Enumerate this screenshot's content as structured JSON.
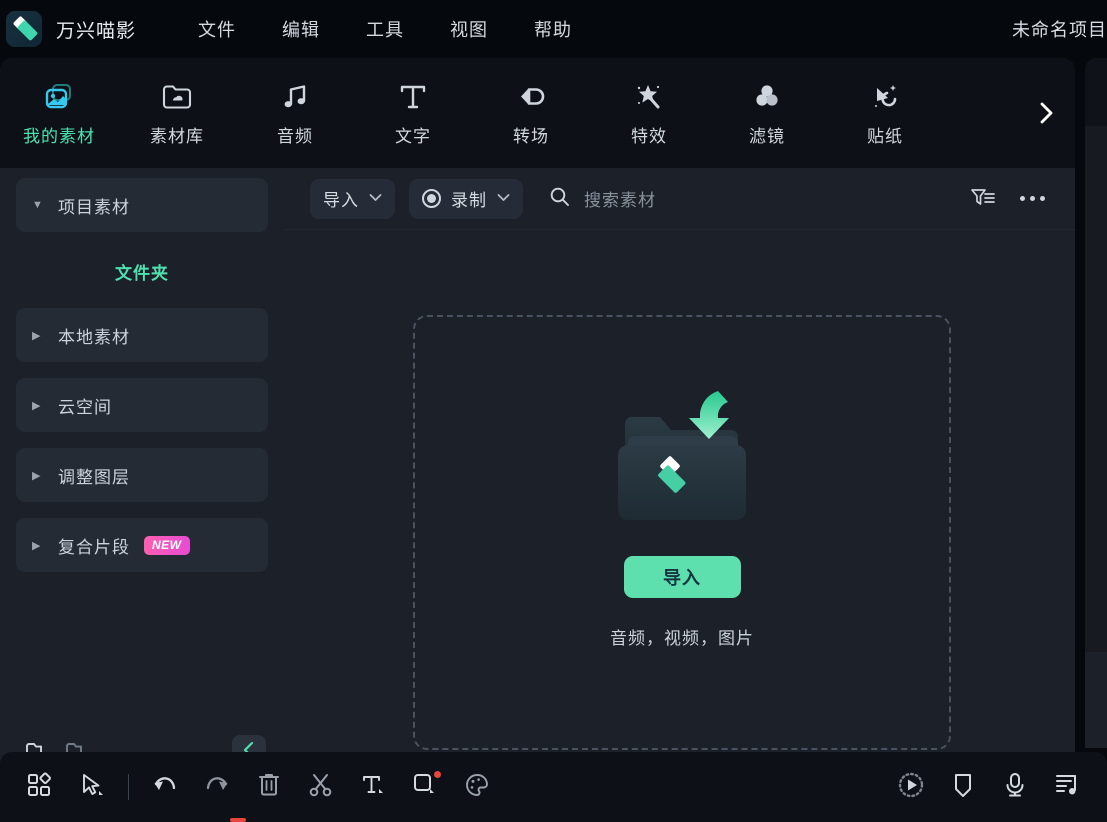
{
  "titlebar": {
    "app_name": "万兴喵影",
    "logo_icon": "wondershare-logo-icon",
    "menus": [
      {
        "label": "文件"
      },
      {
        "label": "编辑"
      },
      {
        "label": "工具"
      },
      {
        "label": "视图"
      },
      {
        "label": "帮助"
      }
    ],
    "project_title": "未命名项目"
  },
  "navbar": {
    "tabs": [
      {
        "label": "我的素材",
        "icon": "photo-stack-icon",
        "active": true
      },
      {
        "label": "素材库",
        "icon": "folder-cloud-icon",
        "active": false
      },
      {
        "label": "音频",
        "icon": "music-note-icon",
        "active": false
      },
      {
        "label": "文字",
        "icon": "text-t-icon",
        "active": false
      },
      {
        "label": "转场",
        "icon": "transition-arrows-icon",
        "active": false
      },
      {
        "label": "特效",
        "icon": "magic-wand-star-icon",
        "active": false
      },
      {
        "label": "滤镜",
        "icon": "color-circles-icon",
        "active": false
      },
      {
        "label": "贴纸",
        "icon": "sticker-shapes-icon",
        "active": false
      }
    ],
    "more_icon": "chevron-right-icon",
    "active_color": "#4fe0b0"
  },
  "sidebar": {
    "items": [
      {
        "label": "项目素材",
        "caret": "caret-down-icon",
        "boxed": true,
        "badge": ""
      },
      {
        "label": "本地素材",
        "caret": "caret-right-icon",
        "boxed": true,
        "badge": ""
      },
      {
        "label": "云空间",
        "caret": "caret-right-icon",
        "boxed": true,
        "badge": ""
      },
      {
        "label": "调整图层",
        "caret": "caret-right-icon",
        "boxed": true,
        "badge": ""
      },
      {
        "label": "复合片段",
        "caret": "caret-right-icon",
        "boxed": true,
        "badge": "NEW"
      }
    ],
    "sub_label": "文件夹",
    "badge_text": "NEW",
    "footer": {
      "new_folder_icon": "folder-add-icon",
      "delete_folder_icon": "folder-delete-icon",
      "collapse_icon": "chevron-left-icon"
    }
  },
  "content": {
    "toolbar": {
      "import_label": "导入",
      "import_caret": "chevron-down-icon",
      "record_label": "录制",
      "record_icon": "record-circle-icon",
      "record_caret": "chevron-down-icon",
      "search_icon": "search-icon",
      "search_placeholder": "搜索素材",
      "filter_icon": "filter-icon",
      "more_icon": "ellipsis-icon"
    },
    "dropzone": {
      "art_icon": "folder-import-arrow-icon",
      "import_button": "导入",
      "hint": "音频，视频，图片"
    }
  },
  "bottombar": {
    "left_tools": [
      {
        "icon": "layout-grid-icon",
        "name": "layout-grid-button",
        "badge": false
      },
      {
        "icon": "cursor-select-icon",
        "name": "select-tool-button",
        "badge": false
      },
      {
        "icon": "separator",
        "name": "toolbar-separator",
        "badge": false
      },
      {
        "icon": "undo-arrow-icon",
        "name": "undo-button",
        "badge": false
      },
      {
        "icon": "redo-arrow-icon",
        "name": "redo-button",
        "badge": false
      },
      {
        "icon": "trash-icon",
        "name": "delete-button",
        "badge": false
      },
      {
        "icon": "scissors-icon",
        "name": "split-button",
        "badge": false
      },
      {
        "icon": "text-tool-icon",
        "name": "text-tool-button",
        "badge": false
      },
      {
        "icon": "crop-square-icon",
        "name": "crop-button",
        "badge": true
      },
      {
        "icon": "palette-icon",
        "name": "color-button",
        "badge": false
      }
    ],
    "right_tools": [
      {
        "icon": "animation-play-icon",
        "name": "animation-button",
        "badge": false
      },
      {
        "icon": "marker-shield-icon",
        "name": "marker-button",
        "badge": false
      },
      {
        "icon": "microphone-icon",
        "name": "voiceover-button",
        "badge": false
      },
      {
        "icon": "audio-mixer-icon",
        "name": "audio-mixer-button",
        "badge": false
      }
    ],
    "playhead_color": "#e8453c"
  },
  "theme": {
    "accent": "#4fe0b0",
    "button_green": "#5ee0ae",
    "panel_bg": "#1b2029",
    "window_bg": "#0d1117",
    "badge_pink": "#ff5fae",
    "alert_red": "#e8453c"
  }
}
